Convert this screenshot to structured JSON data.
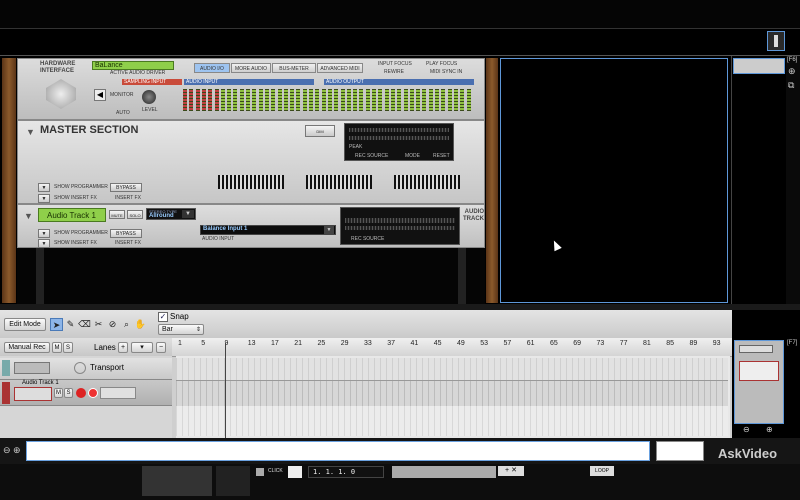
{
  "rack": {
    "hardware_interface": {
      "title": "HARDWARE INTERFACE",
      "driver_name": "BaLance",
      "driver_label": "ACTIVE AUDIO DRIVER",
      "tabs": [
        "AUDIO I/O",
        "MORE AUDIO",
        "BUS-METER",
        "ADVANCED MIDI"
      ],
      "sampling_input": "SAMPLING INPUT",
      "audio_input": "AUDIO INPUT",
      "audio_output": "AUDIO OUTPUT",
      "monitor": "MONITOR",
      "auto": "AUTO",
      "level": "LEVEL",
      "input_focus": "INPUT FOCUS",
      "play_focus": "PLAY FOCUS",
      "rewire": "REWIRE",
      "midi_sync": "MIDI SYNC IN"
    },
    "master_section": {
      "title": "MASTER SECTION",
      "show_programmer": "SHOW PROGRAMMER",
      "show_insert": "SHOW INSERT FX",
      "bypass": "BYPASS",
      "insert_fx": "INSERT FX",
      "peak": "PEAK",
      "rec_source": "REC SOURCE",
      "mode": "MODE",
      "reset": "RESET",
      "dim": "DIM"
    },
    "audio_track": {
      "name": "Audio Track 1",
      "mute": "MUTE",
      "solo": "SOLO",
      "stereo_type": "Allround",
      "stereo_type_label": "STEREO TYPE",
      "input": "Balance Input 1",
      "audio_input_label": "AUDIO INPUT",
      "rec_source": "REC SOURCE",
      "label": "AUDIO TRACK",
      "show_programmer": "SHOW PROGRAMMER",
      "show_insert": "SHOW INSERT FX",
      "bypass": "BYPASS",
      "insert_fx": "INSERT FX"
    }
  },
  "sequencer": {
    "edit_mode": "Edit Mode",
    "snap_label": "Snap",
    "snap_checked": true,
    "snap_value": "Bar",
    "manual_rec": "Manual Rec",
    "m": "M",
    "s": "S",
    "lanes": "Lanes",
    "ruler_ticks": [
      "1",
      "5",
      "9",
      "13",
      "17",
      "21",
      "25",
      "29",
      "33",
      "37",
      "41",
      "45",
      "49",
      "53",
      "57",
      "61",
      "65",
      "69",
      "73",
      "77",
      "81",
      "85",
      "89",
      "93"
    ],
    "tracks": [
      {
        "name": "Transport"
      },
      {
        "name": "Audio Track 1"
      }
    ],
    "f6": "[F6]",
    "f7": "[F7]"
  },
  "transport": {
    "click": "CLICK",
    "position": "1.  1.  1.    0",
    "loop": "LOOP"
  },
  "watermark": "AskVideo"
}
